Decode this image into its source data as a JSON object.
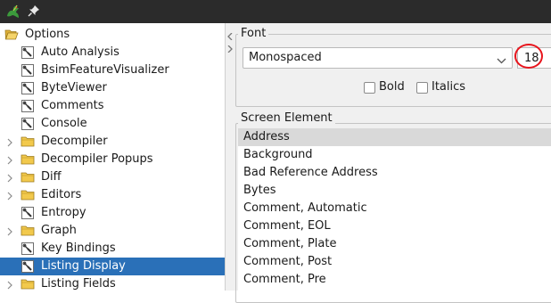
{
  "window": {
    "app_icon": "dragon-icon",
    "pin_icon": "pin-icon"
  },
  "tree": {
    "root": {
      "label": "Options",
      "icon": "open-folder-icon",
      "expanded": true
    },
    "items": [
      {
        "label": "Auto Analysis",
        "kind": "leaf",
        "selected": false
      },
      {
        "label": "BsimFeatureVisualizer",
        "kind": "leaf",
        "selected": false
      },
      {
        "label": "ByteViewer",
        "kind": "leaf",
        "selected": false
      },
      {
        "label": "Comments",
        "kind": "leaf",
        "selected": false
      },
      {
        "label": "Console",
        "kind": "leaf",
        "selected": false
      },
      {
        "label": "Decompiler",
        "kind": "folder",
        "selected": false
      },
      {
        "label": "Decompiler Popups",
        "kind": "folder",
        "selected": false
      },
      {
        "label": "Diff",
        "kind": "folder",
        "selected": false
      },
      {
        "label": "Editors",
        "kind": "folder",
        "selected": false
      },
      {
        "label": "Entropy",
        "kind": "leaf",
        "selected": false
      },
      {
        "label": "Graph",
        "kind": "folder",
        "selected": false
      },
      {
        "label": "Key Bindings",
        "kind": "leaf",
        "selected": false
      },
      {
        "label": "Listing Display",
        "kind": "leaf",
        "selected": true
      },
      {
        "label": "Listing Fields",
        "kind": "folder",
        "selected": false
      }
    ],
    "selected_color": "#2a70b8"
  },
  "font_group": {
    "title": "Font",
    "font_name": "Monospaced",
    "font_size": "18",
    "bold_label": "Bold",
    "bold_checked": false,
    "italics_label": "Italics",
    "italics_checked": false,
    "highlight_color": "#e8141c"
  },
  "screen_element_group": {
    "title": "Screen Element",
    "items": [
      {
        "label": "Address",
        "selected": true
      },
      {
        "label": "Background",
        "selected": false
      },
      {
        "label": "Bad Reference Address",
        "selected": false
      },
      {
        "label": "Bytes",
        "selected": false
      },
      {
        "label": "Comment, Automatic",
        "selected": false
      },
      {
        "label": "Comment, EOL",
        "selected": false
      },
      {
        "label": "Comment, Plate",
        "selected": false
      },
      {
        "label": "Comment, Post",
        "selected": false
      },
      {
        "label": "Comment, Pre",
        "selected": false
      }
    ]
  }
}
